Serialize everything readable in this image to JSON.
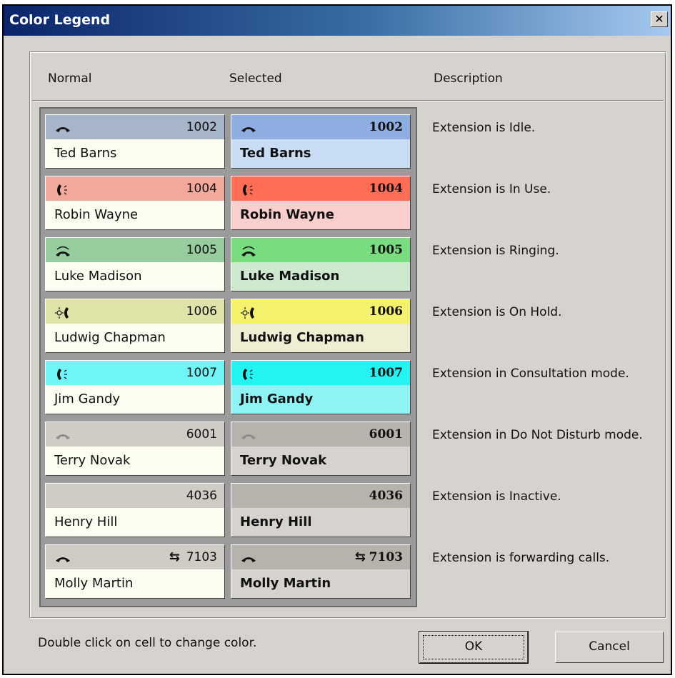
{
  "window": {
    "title": "Color Legend",
    "close_label": "x"
  },
  "headers": {
    "normal": "Normal",
    "selected": "Selected",
    "description": "Description"
  },
  "rows": [
    {
      "ext": "1002",
      "name": "Ted Barns",
      "icon": "handset-idle-icon",
      "desc": "Extension is Idle.",
      "normal_top": "#a7b5c9",
      "normal_bot": "#fdfcf0",
      "sel_top": "#8eaee1",
      "sel_bot": "#c8dcf4"
    },
    {
      "ext": "1004",
      "name": "Robin Wayne",
      "icon": "phone-in-use-icon",
      "desc": "Extension is In Use.",
      "normal_top": "#f2a89a",
      "normal_bot": "#fdfcf0",
      "sel_top": "#ff6e54",
      "sel_bot": "#f9cfcd"
    },
    {
      "ext": "1005",
      "name": "Luke Madison",
      "icon": "handset-ringing-icon",
      "desc": "Extension is Ringing.",
      "normal_top": "#97cc9f",
      "normal_bot": "#fdfcf0",
      "sel_top": "#79dd7f",
      "sel_bot": "#cfe9cf"
    },
    {
      "ext": "1006",
      "name": "Ludwig Chapman",
      "icon": "phone-on-hold-icon",
      "desc": "Extension is On Hold.",
      "normal_top": "#dfe3a8",
      "normal_bot": "#fdfcf0",
      "sel_top": "#f5f36d",
      "sel_bot": "#efedd2"
    },
    {
      "ext": "1007",
      "name": "Jim Gandy",
      "icon": "phone-consult-icon",
      "desc": "Extension in Consultation mode.",
      "normal_top": "#6ff5f6",
      "normal_bot": "#fdfcf0",
      "sel_top": "#22f4f4",
      "sel_bot": "#8ef3f5"
    },
    {
      "ext": "6001",
      "name": "Terry Novak",
      "icon": "handset-dnd-icon",
      "desc": "Extension in Do Not Disturb mode.",
      "normal_top": "#cfccc6",
      "normal_bot": "#fdfcf0",
      "sel_top": "#b6b2ac",
      "sel_bot": "#d6d3ce"
    },
    {
      "ext": "4036",
      "name": "Henry Hill",
      "icon": "",
      "desc": "Extension is Inactive.",
      "normal_top": "#cfccc6",
      "normal_bot": "#fdfcf0",
      "sel_top": "#b6b2ac",
      "sel_bot": "#d6d3ce"
    },
    {
      "ext": "7103",
      "name": "Molly Martin",
      "icon": "handset-idle-icon",
      "desc": "Extension is forwarding calls.",
      "normal_top": "#cfccc6",
      "normal_bot": "#fdfcf0",
      "sel_top": "#b6b2ac",
      "sel_bot": "#d6d3ce",
      "forward_icon": "forward-arrows-icon",
      "forward_glyph": "⇆"
    }
  ],
  "footer": {
    "hint": "Double click on cell to change color.",
    "ok_label": "OK",
    "cancel_label": "Cancel"
  }
}
